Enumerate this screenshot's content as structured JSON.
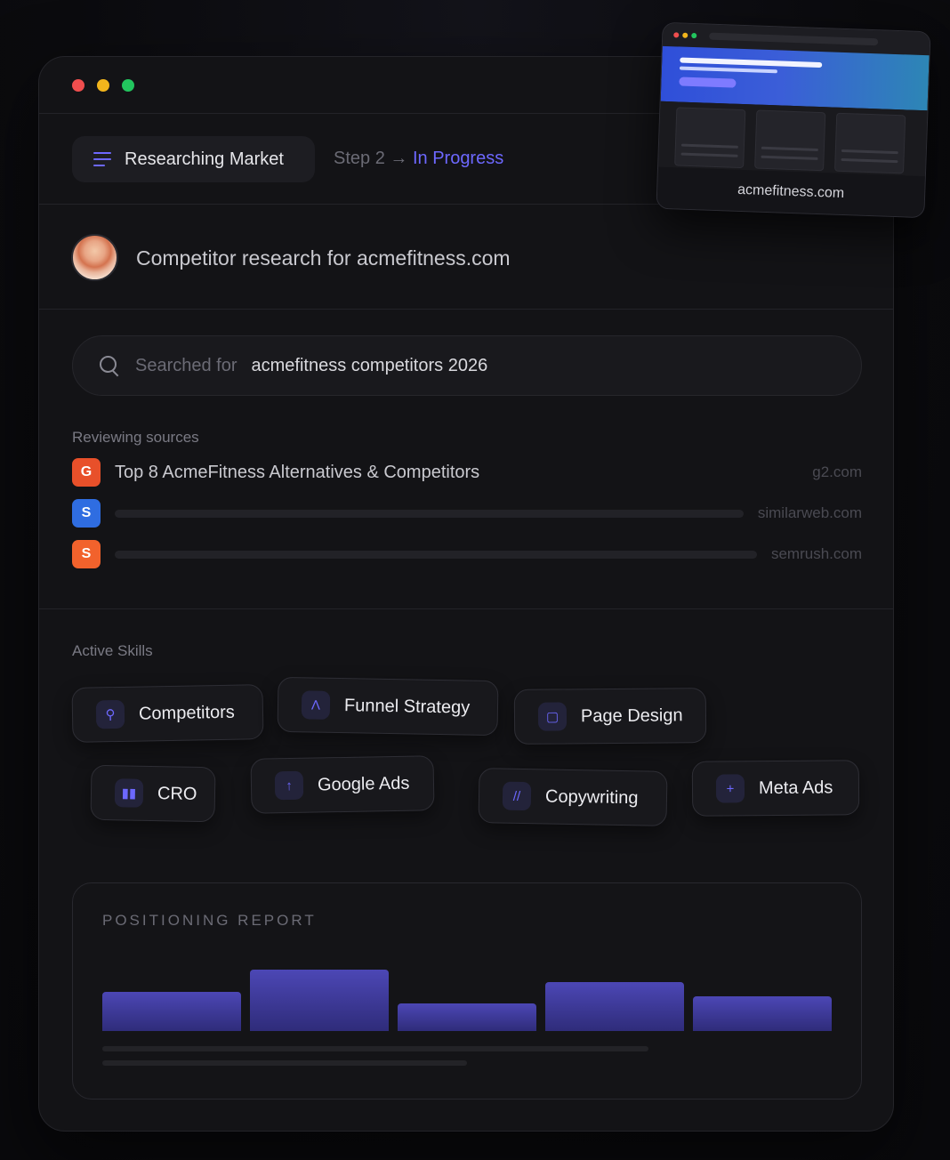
{
  "header": {
    "task_label": "Researching Market",
    "step_label": "Step 2 →",
    "step_status": "In Progress"
  },
  "prompt": {
    "text": "Competitor research for acmefitness.com"
  },
  "search": {
    "label": "Searched for",
    "query": "acmefitness competitors 2026"
  },
  "sources": {
    "heading": "Reviewing sources",
    "items": [
      {
        "badge": "G",
        "badge_color": "#e8502a",
        "title": "Top 8 AcmeFitness Alternatives & Competitors",
        "domain": "g2.com"
      },
      {
        "badge": "S",
        "badge_color": "#2f6de1",
        "title": "",
        "domain": "similarweb.com"
      },
      {
        "badge": "S",
        "badge_color": "#f2622c",
        "title": "",
        "domain": "semrush.com"
      }
    ]
  },
  "skills": {
    "heading": "Active Skills",
    "items": [
      {
        "label": "Competitors",
        "icon": "search-icon"
      },
      {
        "label": "Funnel Strategy",
        "icon": "chevron-up-icon"
      },
      {
        "label": "Page Design",
        "icon": "square-icon"
      },
      {
        "label": "CRO",
        "icon": "bar-chart-icon"
      },
      {
        "label": "Google Ads",
        "icon": "arrow-up-icon"
      },
      {
        "label": "Copywriting",
        "icon": "slashes-icon"
      },
      {
        "label": "Meta Ads",
        "icon": "plus-icon"
      }
    ]
  },
  "report": {
    "title": "POSITIONING REPORT",
    "bar_levels": [
      0.46,
      0.72,
      0.32,
      0.57,
      0.41
    ]
  },
  "preview": {
    "domain": "acmefitness.com"
  },
  "colors": {
    "accent": "#6d68ff",
    "traffic_red": "#ef4e4e",
    "traffic_yellow": "#f2b51c",
    "traffic_green": "#22c55e"
  }
}
